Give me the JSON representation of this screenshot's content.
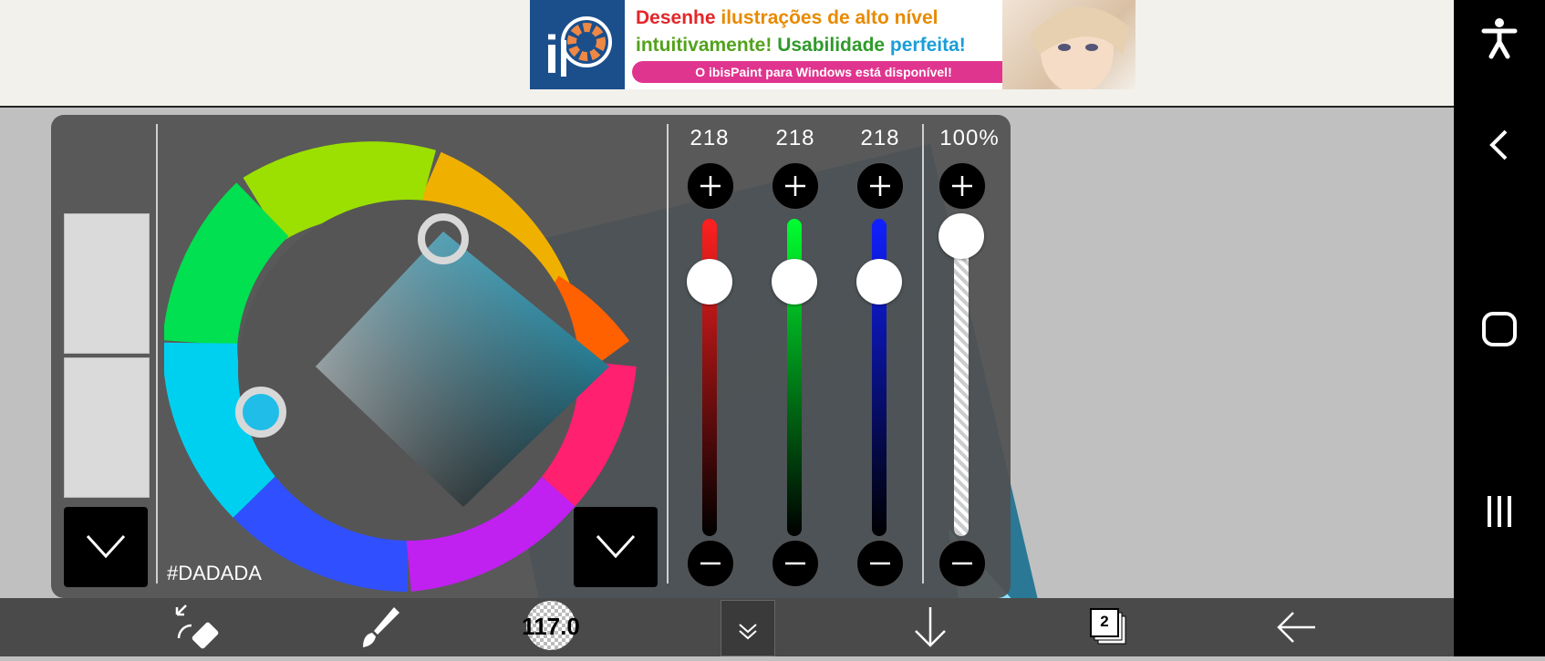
{
  "ad": {
    "line1a": "Desenhe",
    "line1b": "ilustrações de alto nível",
    "line2a": "intuitivamente!",
    "line2b": "Usabilidade",
    "line2c": "perfeita!",
    "line3": "O ibisPaint para Windows está disponível!"
  },
  "color_panel": {
    "hex": "#DADADA",
    "channels": [
      {
        "name": "red",
        "value": "218",
        "level": 0.855
      },
      {
        "name": "green",
        "value": "218",
        "level": 0.855
      },
      {
        "name": "blue",
        "value": "218",
        "level": 0.855
      }
    ],
    "alpha": {
      "value": "100%",
      "level": 1.0
    }
  },
  "toolbar": {
    "brush_size": "117.0",
    "layer_count": "2"
  },
  "colors": {
    "panel": "#505050",
    "wheel_selector": "#1fbde8",
    "accent_teal": "#1e8fb0"
  }
}
